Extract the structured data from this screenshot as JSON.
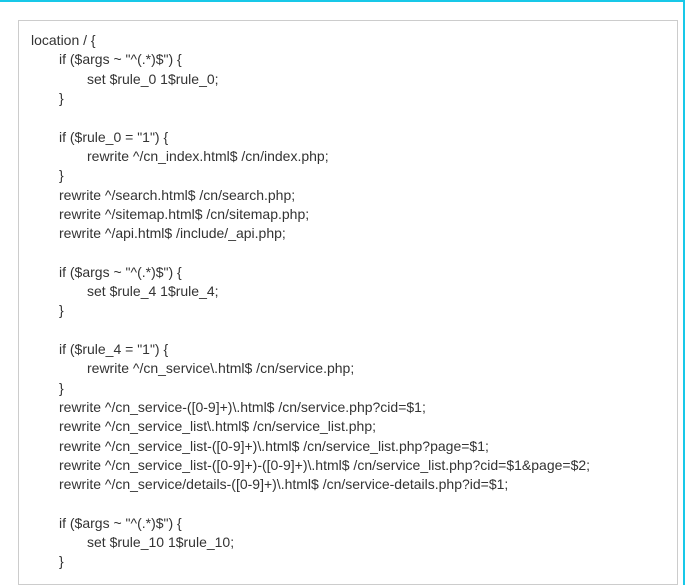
{
  "code": {
    "l01": "location / {",
    "l02": "if ($args ~ \"^(.*)$\") {",
    "l03": "set $rule_0 1$rule_0;",
    "l04": "}",
    "l05": "",
    "l06": "if ($rule_0 = \"1\") {",
    "l07": "rewrite ^/cn_index.html$ /cn/index.php;",
    "l08": "}",
    "l09": "rewrite ^/search.html$ /cn/search.php;",
    "l10": "rewrite ^/sitemap.html$ /cn/sitemap.php;",
    "l11": "rewrite ^/api.html$ /include/_api.php;",
    "l12": "",
    "l13": "if ($args ~ \"^(.*)$\") {",
    "l14": "set $rule_4 1$rule_4;",
    "l15": "}",
    "l16": "",
    "l17": "if ($rule_4 = \"1\") {",
    "l18": "rewrite ^/cn_service\\.html$ /cn/service.php;",
    "l19": "}",
    "l20": "rewrite ^/cn_service-([0-9]+)\\.html$ /cn/service.php?cid=$1;",
    "l21": "rewrite ^/cn_service_list\\.html$ /cn/service_list.php;",
    "l22": "rewrite ^/cn_service_list-([0-9]+)\\.html$ /cn/service_list.php?page=$1;",
    "l23": "rewrite ^/cn_service_list-([0-9]+)-([0-9]+)\\.html$ /cn/service_list.php?cid=$1&page=$2;",
    "l24": "rewrite ^/cn_service/details-([0-9]+)\\.html$ /cn/service-details.php?id=$1;",
    "l25": "",
    "l26": "if ($args ~ \"^(.*)$\") {",
    "l27": "set $rule_10 1$rule_10;",
    "l28": "}"
  }
}
